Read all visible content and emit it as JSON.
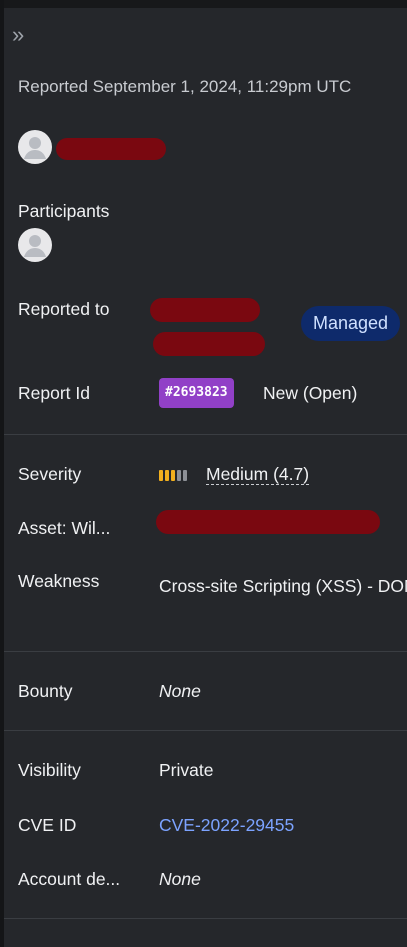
{
  "panel": {
    "collapse_icon": "double-chevron-right-icon",
    "reported_line": "Reported September 1, 2024, 11:29pm UTC"
  },
  "participants": {
    "label": "Participants"
  },
  "reported_to": {
    "label": "Reported to",
    "badge": "Managed"
  },
  "report_id": {
    "label": "Report Id",
    "badge": "#2693823",
    "status": "New (Open)"
  },
  "severity": {
    "label": "Severity",
    "value": "Medium (4.7)",
    "colors": [
      "#f2b01e",
      "#f2b01e",
      "#f2b01e",
      "#8d9096",
      "#8d9096"
    ]
  },
  "asset": {
    "label": "Asset: Wil..."
  },
  "weakness": {
    "label": "Weakness",
    "value": "Cross-site Scripting (XSS) - DOM"
  },
  "bounty": {
    "label": "Bounty",
    "value": "None"
  },
  "visibility": {
    "label": "Visibility",
    "value": "Private"
  },
  "cve": {
    "label": "CVE ID",
    "value": "CVE-2022-29455"
  },
  "account_details": {
    "label": "Account de...",
    "value": "None"
  }
}
